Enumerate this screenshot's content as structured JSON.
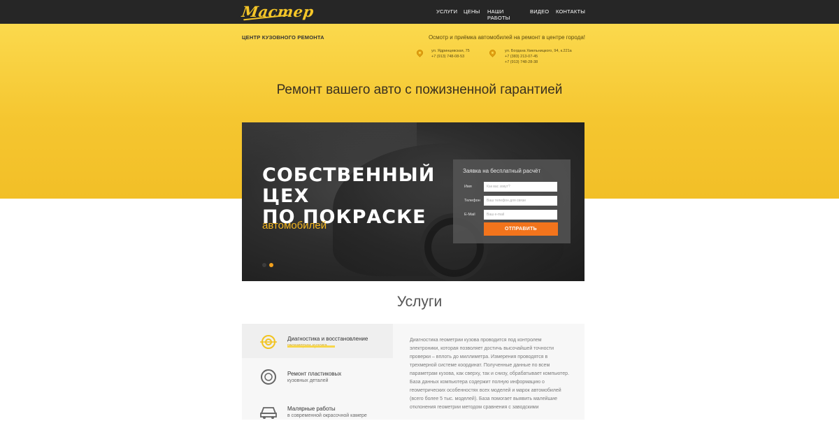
{
  "header": {
    "logo": "Мастер",
    "nav": [
      "Услуги",
      "Цены",
      "Наши работы",
      "Видео",
      "Контакты"
    ]
  },
  "top": {
    "center_title": "ЦЕНТР КУЗОВНОГО РЕМОНТА",
    "promo": "Осмотр и приёмка автомобилей на ремонт в центре города!",
    "addresses": [
      {
        "lines": [
          "ул. Ядринцевская, 75",
          "+7 (913) 748-08-53"
        ]
      },
      {
        "lines": [
          "ул. Богдана Хмельницкого, 94, к.221а",
          "+7 (383) 213-07-45",
          "+7 (913) 748-28-38"
        ]
      }
    ]
  },
  "headline": "Ремонт вашего авто с пожизненной гарантией",
  "banner": {
    "title_lines": [
      "СОБСТВЕННЫЙ",
      "ЦЕХ",
      "ПО ПОКРАСКЕ"
    ],
    "subtitle": "автомобилей",
    "slider_dots": 2,
    "active_dot": 1
  },
  "form": {
    "title": "Заявка на бесплатный расчёт",
    "fields": [
      {
        "label": "Имя",
        "placeholder": "Как вас зовут?"
      },
      {
        "label": "Телефон",
        "placeholder": "Ваш телефон для связи"
      },
      {
        "label": "E-Mail",
        "placeholder": "Ваш e-mail"
      }
    ],
    "submit": "ОТПРАВИТЬ"
  },
  "services": {
    "title": "Услуги",
    "items": [
      {
        "line1": "Диагностика и восстановление",
        "line2": "геометрии кузова",
        "icon": "target-icon",
        "active": true
      },
      {
        "line1": "Ремонт пластиковых",
        "line2": "кузовных деталей",
        "icon": "tire-icon",
        "active": false
      },
      {
        "line1": "Малярные работы",
        "line2": "в современной окрасочной камере",
        "icon": "car-icon",
        "active": false
      }
    ],
    "description": "Диагностика геометрии кузова проводится под контролем электроники, которая позволяет достичь высочайшей точности проверки – вплоть до миллиметра. Измерения проводятся в трехмерной системе координат. Полученные данные по всем параметрам кузова, как сверху, так и снизу, обрабатывает компьютер. База данных компьютера содержит полную информацию о геометрических особенностях всех моделей и марок автомобилей (всего более 5 тыс. моделей). База помогает выявить малейшие отклонения геометрии методом сравнения с заводскими"
  },
  "colors": {
    "accent_yellow": "#f5c630",
    "button_orange": "#f3741c",
    "dark_bar": "#262626"
  }
}
